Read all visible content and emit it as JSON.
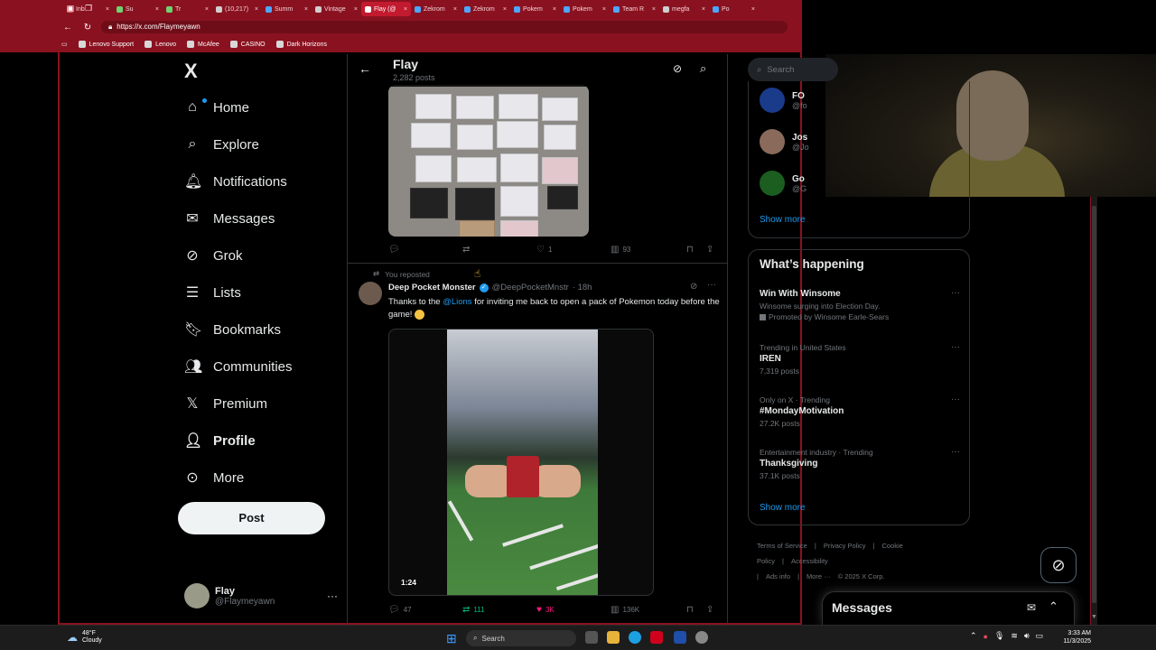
{
  "browser": {
    "tabs": [
      {
        "title": "Inb",
        "color": "#e04b5a",
        "active": false
      },
      {
        "title": "Su",
        "color": "#6fd46f",
        "active": false
      },
      {
        "title": "Tr",
        "color": "#6fd46f",
        "active": false
      },
      {
        "title": "(10,217)",
        "color": "#cfcfcf",
        "active": false
      },
      {
        "title": "Summ",
        "color": "#4da6ff",
        "active": false
      },
      {
        "title": "Vintage",
        "color": "#cfcfcf",
        "active": false
      },
      {
        "title": "Flay (@",
        "color": "#ffffff",
        "active": true
      },
      {
        "title": "Zekrom",
        "color": "#4da6ff",
        "active": false
      },
      {
        "title": "Zekrom",
        "color": "#4da6ff",
        "active": false
      },
      {
        "title": "Pokem",
        "color": "#4da6ff",
        "active": false
      },
      {
        "title": "Pokem",
        "color": "#4da6ff",
        "active": false
      },
      {
        "title": "Team R",
        "color": "#4da6ff",
        "active": false
      },
      {
        "title": "megfa",
        "color": "#cfcfcf",
        "active": false
      },
      {
        "title": "Po",
        "color": "#4da6ff",
        "active": false
      }
    ],
    "url": "https://x.com/Flaymeyawn",
    "bookmarks": [
      "Lenovo Support",
      "Lenovo",
      "McAfee",
      "CASINO",
      "Dark Horizons"
    ]
  },
  "nav": {
    "logo": "X",
    "items": [
      {
        "label": "Home",
        "icon": "home-icon"
      },
      {
        "label": "Explore",
        "icon": "search-icon"
      },
      {
        "label": "Notifications",
        "icon": "bell-icon"
      },
      {
        "label": "Messages",
        "icon": "envelope-icon"
      },
      {
        "label": "Grok",
        "icon": "grok-icon"
      },
      {
        "label": "Lists",
        "icon": "list-icon"
      },
      {
        "label": "Bookmarks",
        "icon": "bookmark-icon"
      },
      {
        "label": "Communities",
        "icon": "people-icon"
      },
      {
        "label": "Premium",
        "icon": "x-icon"
      },
      {
        "label": "Profile",
        "icon": "person-icon"
      },
      {
        "label": "More",
        "icon": "more-circle-icon"
      }
    ],
    "post_button": "Post",
    "account": {
      "name": "Flay",
      "handle": "@Flaymeyawn"
    }
  },
  "profile_header": {
    "name": "Flay",
    "post_count": "2,282 posts"
  },
  "post1": {
    "replies": "",
    "reposts": "",
    "likes": "1",
    "views": "93"
  },
  "post2": {
    "reposted_label": "You reposted",
    "author": "Deep Pocket Monster",
    "handle": "@DeepPocketMnstr",
    "time": "· 18h",
    "text_before": "Thanks to the ",
    "mention": "@Lions",
    "text_after": " for inviting me back to open a pack of Pokemon today before the game!",
    "video_duration": "1:24",
    "replies": "47",
    "reposts": "111",
    "likes": "3K",
    "views": "136K"
  },
  "sidebar": {
    "search_placeholder": "Search",
    "who_to_follow": [
      {
        "name": "FO",
        "handle": "@fo",
        "avatar_color": "#1a3a8a"
      },
      {
        "name": "Jos",
        "handle": "@Jo",
        "avatar_color": "#8a6a5a"
      },
      {
        "name": "Go",
        "handle": "@G",
        "avatar_color": "#1b5e20"
      }
    ],
    "show_more": "Show more",
    "happening_title": "What’s happening",
    "trends": [
      {
        "context": "",
        "title": "Win With Winsome",
        "subtitle": "Winsome surging into Election Day.",
        "promo": "Promoted by Winsome Earle-Sears"
      },
      {
        "context": "Trending in United States",
        "title": "IREN",
        "subtitle": "7,319 posts",
        "promo": ""
      },
      {
        "context": "Only on X · Trending",
        "title": "#MondayMotivation",
        "subtitle": "27.2K posts",
        "promo": ""
      },
      {
        "context": "Entertainment industry · Trending",
        "title": "Thanksgiving",
        "subtitle": "37.1K posts",
        "promo": ""
      }
    ],
    "show_more_2": "Show more",
    "footer": [
      "Terms of Service",
      "|",
      "Privacy Policy",
      "|",
      "Cookie Policy",
      "|",
      "Accessibility",
      "|",
      "Ads info",
      "|",
      "More ···",
      "© 2025 X Corp."
    ]
  },
  "messages_drawer": {
    "title": "Messages"
  },
  "taskbar": {
    "weather_temp": "48°F",
    "weather_desc": "Cloudy",
    "search_placeholder": "Search",
    "time": "3:33 AM",
    "date": "11/3/2025"
  },
  "colors": {
    "accent": "#1d9bf0",
    "like": "#f91880",
    "repost": "#00ba7c",
    "browser_frame": "#8a1220"
  }
}
